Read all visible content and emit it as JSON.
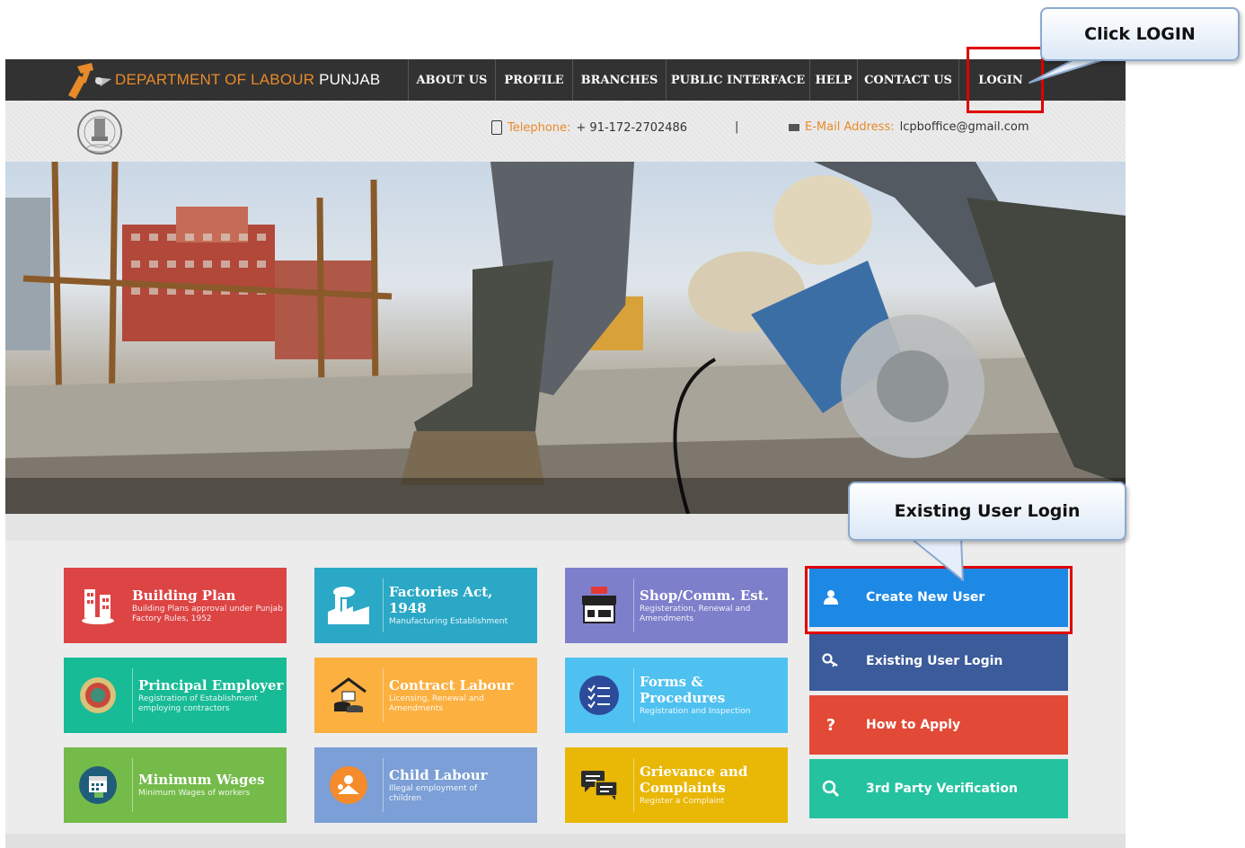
{
  "brand": {
    "name_part1": "DEPARTMENT OF LABOUR",
    "name_part2": "PUNJAB"
  },
  "nav": {
    "items": [
      {
        "label": "ABOUT US"
      },
      {
        "label": "PROFILE"
      },
      {
        "label": "BRANCHES"
      },
      {
        "label": "PUBLIC INTERFACE"
      },
      {
        "label": "HELP"
      },
      {
        "label": "CONTACT US"
      },
      {
        "label": "LOGIN"
      }
    ]
  },
  "contact": {
    "phone_label": "Telephone:",
    "phone_value": "+ 91-172-2702486",
    "separator": "|",
    "email_label": "E-Mail Address:",
    "email_value": "lcpboffice@gmail.com"
  },
  "tiles": [
    {
      "title": "Building Plan",
      "subtitle": "Building Plans approval under Punjab Factory Rules, 1952",
      "color": "#dd4444",
      "icon": "building-icon"
    },
    {
      "title": "Factories Act, 1948",
      "subtitle": "Manufacturing Establishment",
      "color": "#2aa8c6",
      "icon": "factory-icon"
    },
    {
      "title": "Shop/Comm. Est.",
      "subtitle": "Registeration, Renewal and Amendments",
      "color": "#7d7fcb",
      "icon": "shop-icon"
    },
    {
      "title": "Principal Employer",
      "subtitle": "Registration of Establishment employing contractors",
      "color": "#17bb96",
      "icon": "emblem-icon"
    },
    {
      "title": "Contract Labour",
      "subtitle": "Licensing, Renewal and Amendments",
      "color": "#fbb040",
      "icon": "house-coins-icon"
    },
    {
      "title": "Forms & Procedures",
      "subtitle": "Registration and Inspection",
      "color": "#4fc1f0",
      "icon": "checklist-icon"
    },
    {
      "title": "Minimum Wages",
      "subtitle": "Minimum Wages of workers",
      "color": "#74bb4a",
      "icon": "calendar-icon"
    },
    {
      "title": "Child Labour",
      "subtitle": "Illegal employment of children",
      "color": "#7b9fd6",
      "icon": "child-icon"
    },
    {
      "title": "Grievance and Complaints",
      "subtitle": "Register a Complaint",
      "color": "#e9b705",
      "icon": "chat-icon"
    }
  ],
  "buttons": [
    {
      "label": "Create New User",
      "color": "#1e88e5",
      "icon": "user-icon",
      "glyph": ""
    },
    {
      "label": "Existing User Login",
      "color": "#3b5b9a",
      "icon": "key-icon",
      "glyph": ""
    },
    {
      "label": "How to Apply",
      "color": "#e24a37",
      "icon": "question-icon",
      "glyph": "?"
    },
    {
      "label": "3rd Party Verification",
      "color": "#25c2a0",
      "icon": "search-icon",
      "glyph": ""
    }
  ],
  "annotations": {
    "callout_login": "Click LOGIN",
    "callout_existing": "Existing User Login"
  },
  "colors": {
    "accent": "#e88a2a",
    "nav_bg": "#323232",
    "highlight": "#e00000"
  }
}
